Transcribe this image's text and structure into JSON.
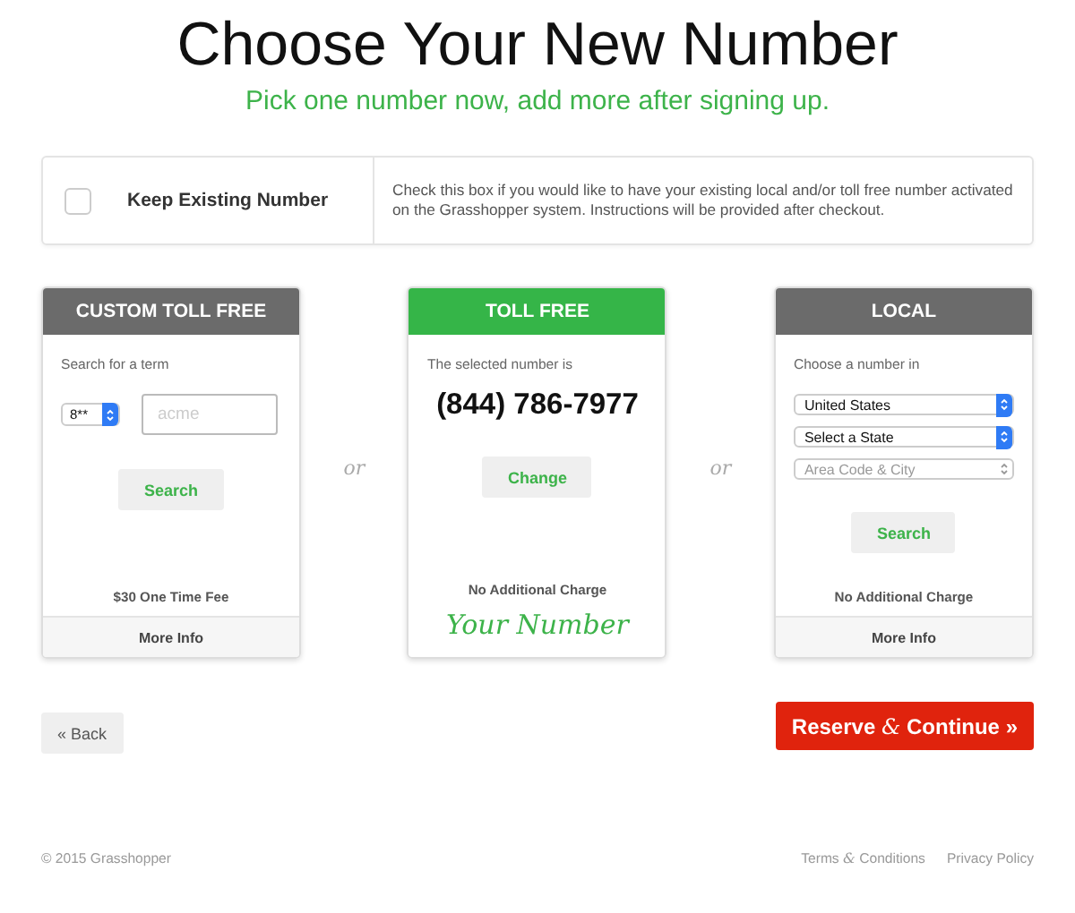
{
  "title": "Choose Your New Number",
  "subtitle": "Pick one number now, add more after signing up.",
  "keep_existing": {
    "checked": false,
    "label": "Keep Existing Number",
    "description": "Check this box if you would like to have your existing local and/or toll free number activated on the Grasshopper system. Instructions will be provided after checkout."
  },
  "separators": [
    "or",
    "or"
  ],
  "cards": [
    {
      "kind": "custom",
      "title": "CUSTOM TOLL FREE",
      "selected": false,
      "label": "Search for a term",
      "prefix_select": "8**",
      "term_placeholder": "acme",
      "button": "Search",
      "fee": "$30 One Time Fee",
      "more_info": "More Info"
    },
    {
      "kind": "selected",
      "title": "TOLL FREE",
      "selected": true,
      "label": "The selected number is",
      "number": "(844) 786-7977",
      "button": "Change",
      "fee": "No Additional Charge",
      "note": "Your Number"
    },
    {
      "kind": "local",
      "title": "LOCAL",
      "selected": false,
      "label": "Choose a number in",
      "selects": [
        {
          "value": "United States",
          "disabled": false
        },
        {
          "value": "Select a State",
          "disabled": false
        },
        {
          "value": "Area Code & City",
          "disabled": true
        }
      ],
      "button": "Search",
      "fee": "No Additional Charge",
      "more_info": "More Info"
    }
  ],
  "back_button": "« Back",
  "continue_button": "Reserve *&* Continue »",
  "footer": {
    "copyright": "© 2015 Grasshopper",
    "links": [
      "Terms *&* Conditions",
      "Privacy Policy"
    ]
  }
}
